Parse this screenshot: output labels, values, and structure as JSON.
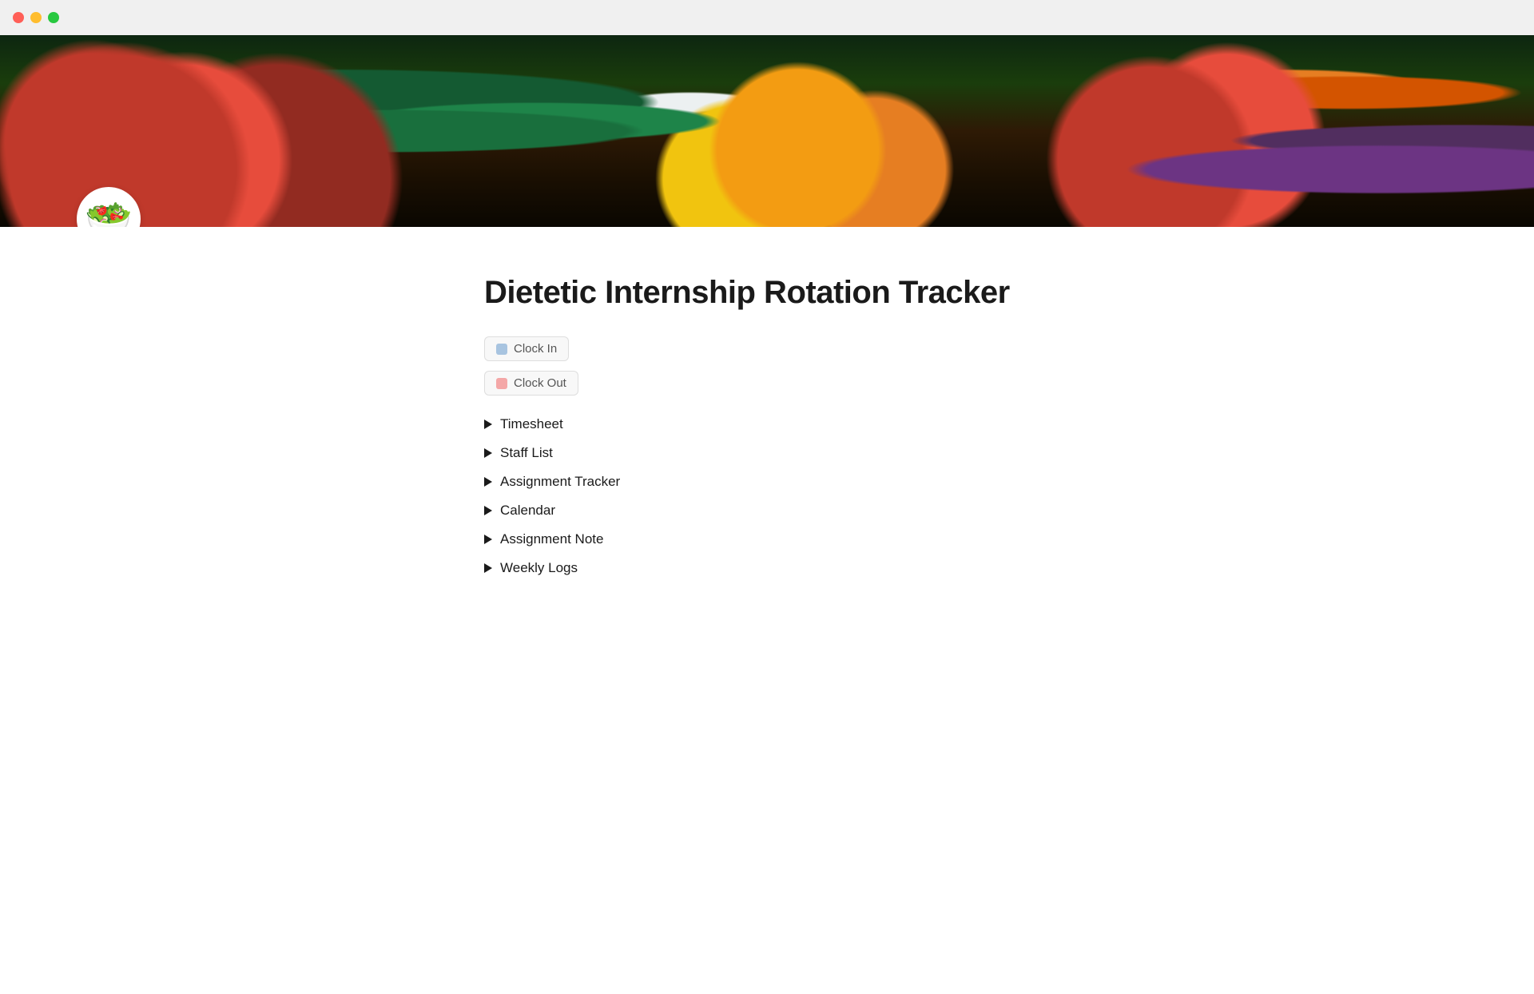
{
  "titlebar": {
    "close_label": "close",
    "minimize_label": "minimize",
    "maximize_label": "maximize"
  },
  "page": {
    "icon": "🥗",
    "title": "Dietetic Internship Rotation Tracker",
    "buttons": [
      {
        "id": "clock-in",
        "label": "Clock In",
        "icon_color": "blue"
      },
      {
        "id": "clock-out",
        "label": "Clock Out",
        "icon_color": "pink"
      }
    ],
    "nav_items": [
      {
        "id": "timesheet",
        "label": "Timesheet"
      },
      {
        "id": "staff-list",
        "label": "Staff List"
      },
      {
        "id": "assignment-tracker",
        "label": "Assignment Tracker"
      },
      {
        "id": "calendar",
        "label": "Calendar"
      },
      {
        "id": "assignment-note",
        "label": "Assignment Note"
      },
      {
        "id": "weekly-logs",
        "label": "Weekly Logs"
      }
    ]
  }
}
